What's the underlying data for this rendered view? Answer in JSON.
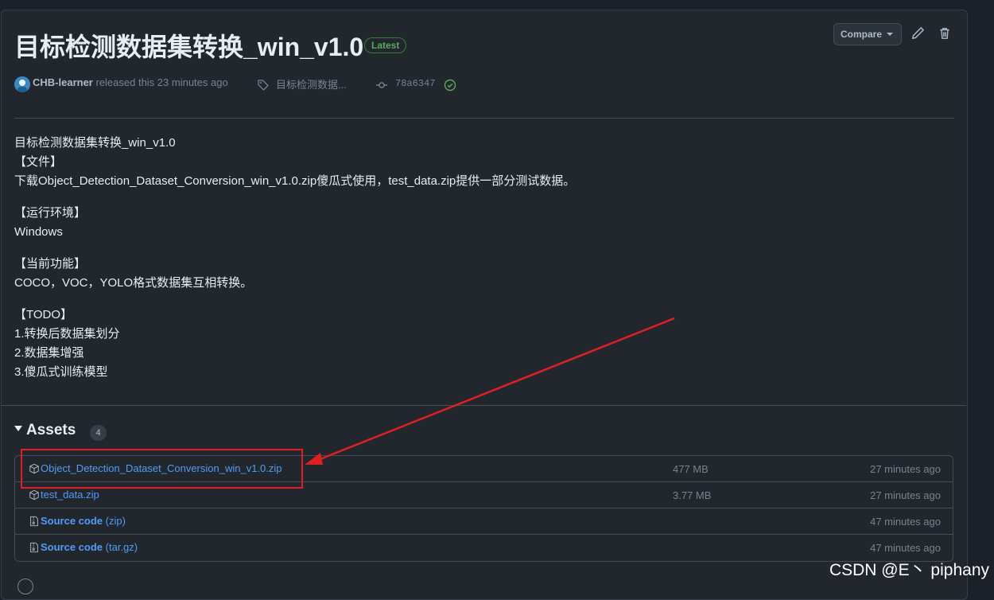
{
  "release": {
    "title": "目标检测数据集转换_win_v1.0",
    "latest_badge": "Latest",
    "compare_label": "Compare",
    "author": "CHB-learner",
    "released_text": "released this 23 minutes ago",
    "tag_text": "目标检测数据...",
    "commit": "78a6347",
    "icons": [
      "pencil-icon",
      "trash-icon",
      "tag-icon",
      "commit-icon",
      "check-circle-icon"
    ]
  },
  "body": {
    "lines": [
      "目标检测数据集转换_win_v1.0",
      "【文件】",
      "下载Object_Detection_Dataset_Conversion_win_v1.0.zip傻瓜式使用，test_data.zip提供一部分测试数据。"
    ],
    "env_heading": "【运行环境】",
    "env_value": "Windows",
    "features_heading": "【当前功能】",
    "features_value": "COCO，VOC，YOLO格式数据集互相转换。",
    "todo_heading": "【TODO】",
    "todo_items": [
      "1.转换后数据集划分",
      "2.数据集增强",
      "3.傻瓜式训练模型"
    ]
  },
  "assets": {
    "heading": "Assets",
    "count": "4",
    "rows": [
      {
        "name": "Object_Detection_Dataset_Conversion_win_v1.0.zip",
        "suffix": "",
        "size": "477 MB",
        "time": "27 minutes ago",
        "icon": "package-icon"
      },
      {
        "name": "test_data.zip",
        "suffix": "",
        "size": "3.77 MB",
        "time": "27 minutes ago",
        "icon": "package-icon"
      },
      {
        "name": "Source code",
        "suffix": "(zip)",
        "size": "",
        "time": "47 minutes ago",
        "icon": "file-zip-icon"
      },
      {
        "name": "Source code",
        "suffix": "(tar.gz)",
        "size": "",
        "time": "47 minutes ago",
        "icon": "file-zip-icon"
      }
    ]
  },
  "watermark": "CSDN @E丶 piphany",
  "colors": {
    "background": "#22272e",
    "link": "#539bf5",
    "annotation": "#e02020",
    "badge": "#57ab5a"
  }
}
